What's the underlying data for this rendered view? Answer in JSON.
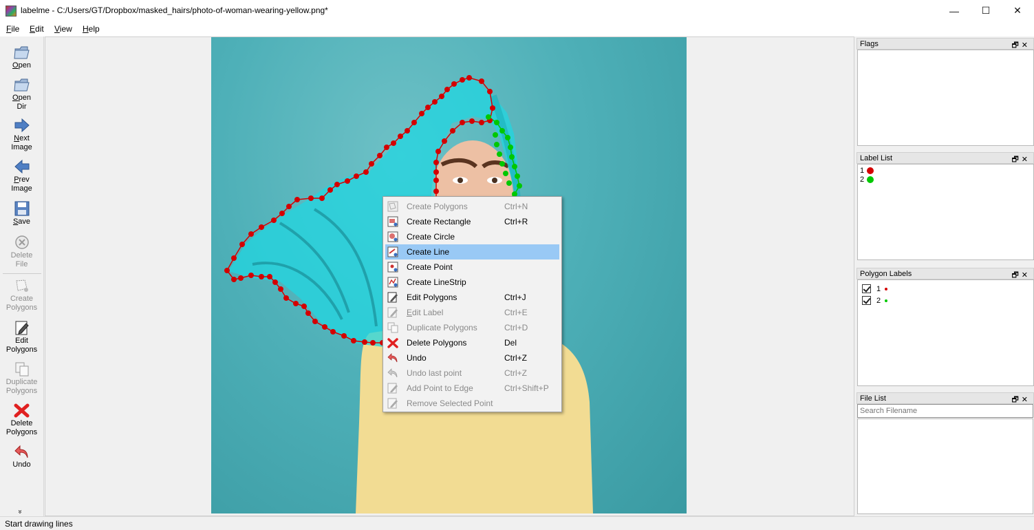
{
  "window": {
    "title": "labelme - C:/Users/GT/Dropbox/masked_hairs/photo-of-woman-wearing-yellow.png*",
    "minimize": "—",
    "maximize": "☐",
    "close": "✕"
  },
  "menu": {
    "file": {
      "u": "F",
      "rest": "ile"
    },
    "edit": {
      "u": "E",
      "rest": "dit"
    },
    "view": {
      "u": "V",
      "rest": "iew"
    },
    "help": {
      "u": "H",
      "rest": "elp"
    }
  },
  "toolbar": {
    "open": {
      "u": "O",
      "rest": "pen"
    },
    "open_dir": {
      "u": "O",
      "rest": "pen",
      "line2": "Dir"
    },
    "next_image": {
      "u": "N",
      "rest": "ext",
      "line2": "Image"
    },
    "prev_image": {
      "u": "P",
      "rest": "rev",
      "line2": "Image"
    },
    "save": {
      "u": "S",
      "rest": "ave"
    },
    "delete_file": {
      "line1": "Delete",
      "line2": "File"
    },
    "create_polygons": {
      "line1": "Create",
      "line2": "Polygons"
    },
    "edit_polygons": {
      "line1": "Edit",
      "line2": "Polygons"
    },
    "duplicate_polygons": {
      "line1": "Duplicate",
      "line2": "Polygons"
    },
    "delete_polygons": {
      "line1": "Delete",
      "line2": "Polygons"
    },
    "undo": {
      "line1": "Undo"
    },
    "more": "»"
  },
  "context_menu": {
    "items": [
      {
        "label": "Create Polygons",
        "shortcut": "Ctrl+N",
        "enabled": false
      },
      {
        "label": "Create Rectangle",
        "shortcut": "Ctrl+R",
        "enabled": true
      },
      {
        "label": "Create Circle",
        "shortcut": "",
        "enabled": true
      },
      {
        "label": "Create Line",
        "shortcut": "",
        "enabled": true,
        "highlighted": true
      },
      {
        "label": "Create Point",
        "shortcut": "",
        "enabled": true
      },
      {
        "label": "Create LineStrip",
        "shortcut": "",
        "enabled": true
      },
      {
        "label": "Edit Polygons",
        "shortcut": "Ctrl+J",
        "enabled": true
      },
      {
        "label": "Edit Label",
        "shortcut": "Ctrl+E",
        "enabled": false
      },
      {
        "label": "Duplicate Polygons",
        "shortcut": "Ctrl+D",
        "enabled": false
      },
      {
        "label": "Delete Polygons",
        "shortcut": "Del",
        "enabled": true
      },
      {
        "label": "Undo",
        "shortcut": "Ctrl+Z",
        "enabled": true
      },
      {
        "label": "Undo last point",
        "shortcut": "Ctrl+Z",
        "enabled": false
      },
      {
        "label": "Add Point to Edge",
        "shortcut": "Ctrl+Shift+P",
        "enabled": false
      },
      {
        "label": "Remove Selected Point",
        "shortcut": "",
        "enabled": false
      }
    ]
  },
  "docks": {
    "flags": {
      "title": "Flags"
    },
    "label_list": {
      "title": "Label List",
      "items": [
        {
          "label": "1",
          "color": "#d40000"
        },
        {
          "label": "2",
          "color": "#00c800"
        }
      ]
    },
    "polygon_labels": {
      "title": "Polygon Labels",
      "items": [
        {
          "label": "1",
          "checked": true,
          "color": "#d40000"
        },
        {
          "label": "2",
          "checked": true,
          "color": "#00c800"
        }
      ]
    },
    "file_list": {
      "title": "File List",
      "search_placeholder": "Search Filename"
    },
    "float_icon": "🗗",
    "close_icon": "✕"
  },
  "status": {
    "text": "Start drawing lines"
  },
  "colors": {
    "polygon_1": "#d40000",
    "polygon_2": "#00c800",
    "hair_mask": "#22d6e0",
    "highlight": "#99c9f5"
  }
}
